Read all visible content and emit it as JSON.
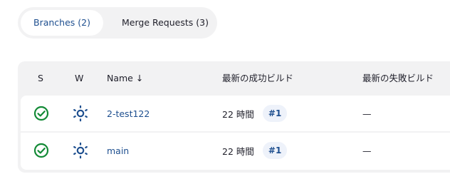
{
  "tabs": {
    "branches": "Branches (2)",
    "merge_requests": "Merge Requests (3)"
  },
  "table": {
    "headers": {
      "status": "S",
      "weather": "W",
      "name": "Name ↓",
      "last_success": "最新の成功ビルド",
      "last_failure": "最新の失敗ビルド"
    },
    "rows": [
      {
        "name": "2-test122",
        "last_success_time": "22 時間",
        "last_success_build": "#1",
        "last_failure": "—",
        "status_icon": "check-circle-icon",
        "weather_icon": "sun-icon"
      },
      {
        "name": "main",
        "last_success_time": "22 時間",
        "last_success_build": "#1",
        "last_failure": "—",
        "status_icon": "check-circle-icon",
        "weather_icon": "sun-icon"
      }
    ]
  },
  "colors": {
    "success": "#138a36",
    "link": "#1e4f8f",
    "weather": "#1e4f8f"
  }
}
